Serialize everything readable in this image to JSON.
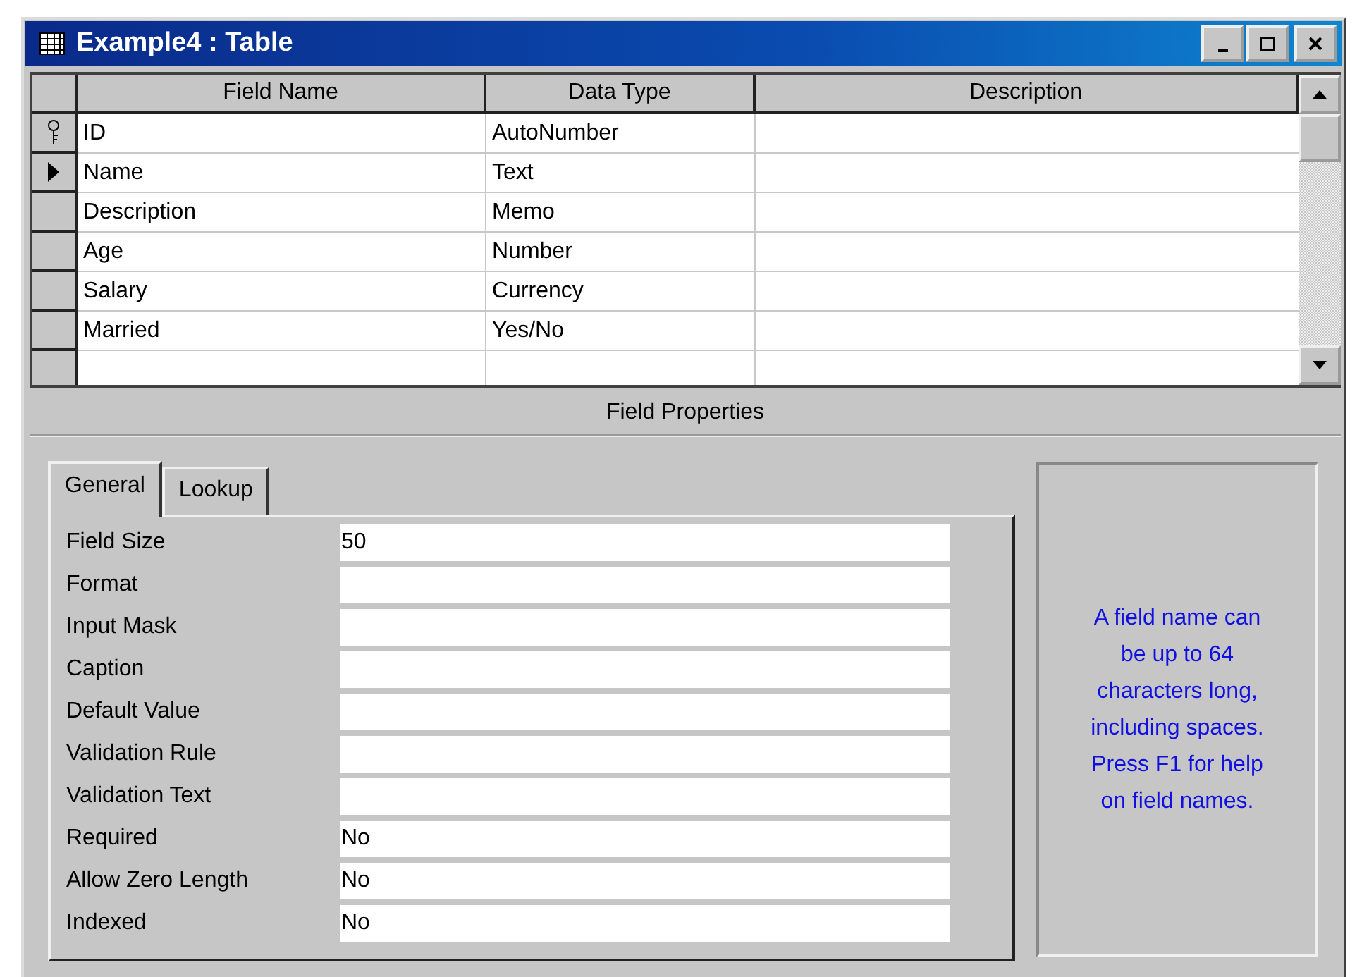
{
  "window": {
    "title": "Example4 : Table"
  },
  "grid": {
    "columns": [
      "Field Name",
      "Data Type",
      "Description"
    ],
    "rows": [
      {
        "kind": "key",
        "field_name": "ID",
        "data_type": "AutoNumber"
      },
      {
        "kind": "current",
        "field_name": "Name",
        "data_type": "Text"
      },
      {
        "kind": "plain",
        "field_name": "Description",
        "data_type": "Memo"
      },
      {
        "kind": "plain",
        "field_name": "Age",
        "data_type": "Number"
      },
      {
        "kind": "plain",
        "field_name": "Salary",
        "data_type": "Currency"
      },
      {
        "kind": "plain",
        "field_name": "Married",
        "data_type": "Yes/No"
      }
    ]
  },
  "field_properties": {
    "title": "Field Properties",
    "tabs": [
      {
        "label": "General",
        "selected": true
      },
      {
        "label": "Lookup",
        "selected": false
      }
    ],
    "properties": [
      {
        "label": "Field Size",
        "value": "50"
      },
      {
        "label": "Format"
      },
      {
        "label": "Input Mask"
      },
      {
        "label": "Caption"
      },
      {
        "label": "Default Value"
      },
      {
        "label": "Validation Rule"
      },
      {
        "label": "Validation Text"
      },
      {
        "label": "Required",
        "value": "No"
      },
      {
        "label": "Allow Zero Length",
        "value": "No"
      },
      {
        "label": "Indexed",
        "value": "No"
      }
    ],
    "help": "A field name can\nbe up to 64\ncharacters long,\nincluding spaces.\nPress F1 for help\non field names."
  }
}
